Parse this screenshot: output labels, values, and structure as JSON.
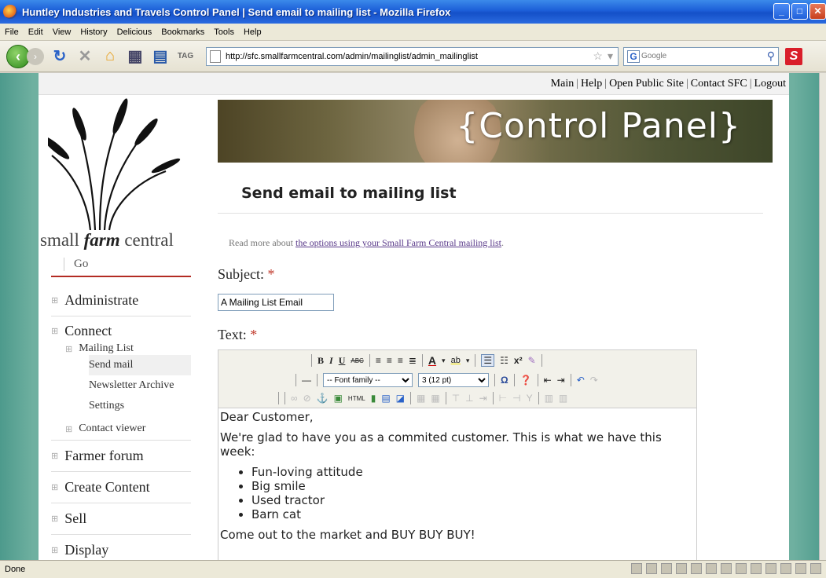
{
  "window": {
    "title": "Huntley Industries and Travels Control Panel | Send email to mailing list - Mozilla Firefox"
  },
  "menubar": [
    "File",
    "Edit",
    "View",
    "History",
    "Delicious",
    "Bookmarks",
    "Tools",
    "Help"
  ],
  "navbar": {
    "url": "http://sfc.smallfarmcentral.com/admin/mailinglist/admin_mailinglist",
    "search_placeholder": "Google",
    "search_engine_letter": "G"
  },
  "topnav": [
    "Main",
    "Help",
    "Open Public Site",
    "Contact SFC",
    "Logout"
  ],
  "sidebar": {
    "logo_part1": "small ",
    "logo_part2": "farm",
    "logo_part3": " central",
    "go": "Go",
    "menu": {
      "administrate": "Administrate",
      "connect": "Connect",
      "mailing_list": "Mailing List",
      "send_mail": "Send mail",
      "newsletter_archive": "Newsletter Archive",
      "settings": "Settings",
      "contact_viewer": "Contact viewer",
      "farmer_forum": "Farmer forum",
      "create_content": "Create Content",
      "sell": "Sell",
      "display": "Display"
    }
  },
  "main": {
    "banner_text": "{Control Panel}",
    "page_title": "Send email to mailing list",
    "readmore_prefix": "Read more about ",
    "readmore_link": "the options using your Small Farm Central mailing list",
    "readmore_suffix": ".",
    "subject_label": "Subject: ",
    "required_mark": "*",
    "subject_value": "A Mailing List Email",
    "text_label": "Text: "
  },
  "editor": {
    "font_family": "-- Font family --",
    "font_size": "3 (12 pt)",
    "greeting": "Dear Customer,",
    "intro": "We're glad to have you as a commited customer. This is what we have this week:",
    "items": [
      "Fun-loving attitude",
      "Big smile",
      "Used tractor",
      "Barn cat"
    ],
    "closing": "Come out to the market and BUY BUY BUY!"
  },
  "statusbar": {
    "text": "Done"
  }
}
